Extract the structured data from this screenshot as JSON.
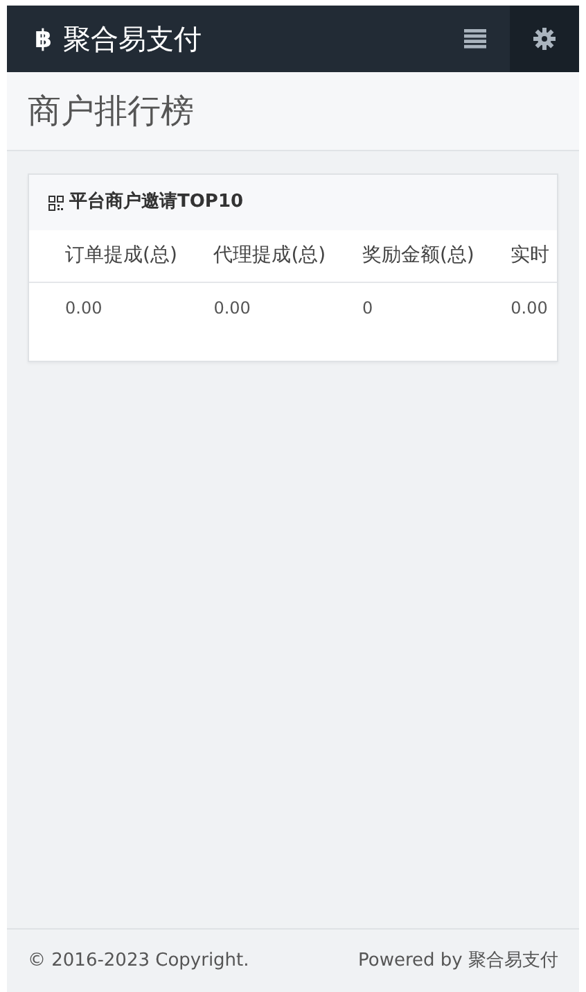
{
  "navbar": {
    "brand_icon": "฿",
    "brand": "聚合易支付"
  },
  "page_header": {
    "title": "商户排行榜"
  },
  "panel": {
    "title": "平台商户邀请TOP10",
    "table": {
      "columns": [
        "订单提成(总)",
        "代理提成(总)",
        "奖励金额(总)",
        "实时"
      ],
      "rows": [
        [
          "0.00",
          "0.00",
          "0",
          "0.00"
        ]
      ]
    }
  },
  "footer": {
    "copyright": "© 2016-2023 Copyright.",
    "powered_by": "Powered by 聚合易支付"
  }
}
